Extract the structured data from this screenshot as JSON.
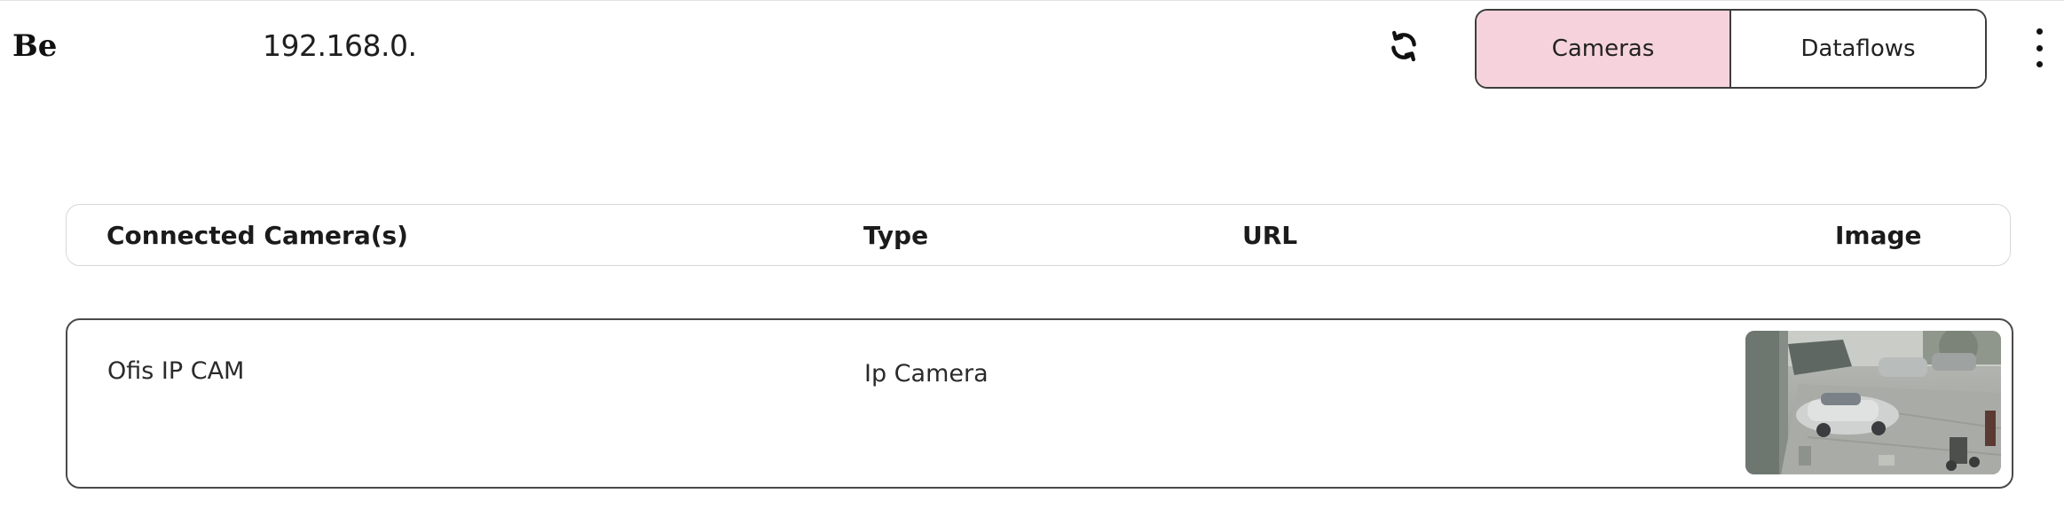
{
  "header": {
    "brand": "Be",
    "ip_address": "192.168.0.",
    "refresh_icon": "refresh-icon",
    "tabs": [
      {
        "label": "Cameras",
        "active": true
      },
      {
        "label": "Dataflows",
        "active": false
      }
    ],
    "menu_icon": "more-vertical-icon"
  },
  "table": {
    "columns": [
      "Connected Camera(s)",
      "Type",
      "URL",
      "Image"
    ],
    "rows": [
      {
        "name": "Ofis IP CAM",
        "type": "Ip Camera",
        "url": "",
        "image": "camera-snapshot"
      }
    ]
  },
  "colors": {
    "active_tab_bg": "#f6d3dc",
    "border_dark": "#3d3d3d",
    "border_light": "#d7d7d7"
  }
}
